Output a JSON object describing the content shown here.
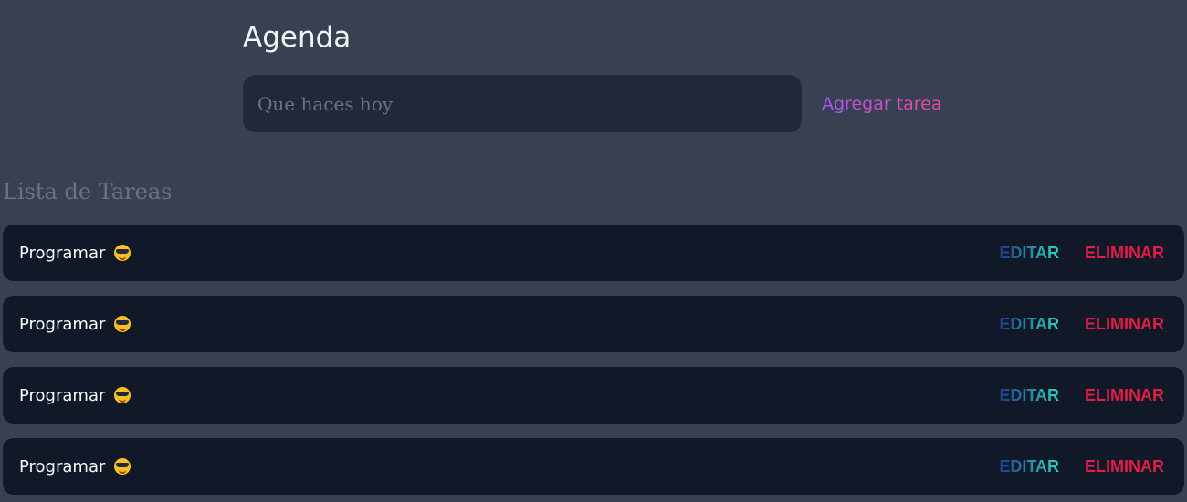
{
  "header": {
    "title": "Agenda"
  },
  "form": {
    "placeholder": "Que haces hoy",
    "value": "",
    "add_label": "Agregar tarea"
  },
  "list": {
    "title": "Lista de Tareas",
    "items": [
      {
        "text": "Programar",
        "icon": "sunglasses-emoji-icon",
        "edit_label": "EDITAR",
        "delete_label": "ELIMINAR"
      },
      {
        "text": "Programar",
        "icon": "sunglasses-emoji-icon",
        "edit_label": "EDITAR",
        "delete_label": "ELIMINAR"
      },
      {
        "text": "Programar",
        "icon": "sunglasses-emoji-icon",
        "edit_label": "EDITAR",
        "delete_label": "ELIMINAR"
      },
      {
        "text": "Programar",
        "icon": "sunglasses-emoji-icon",
        "edit_label": "EDITAR",
        "delete_label": "ELIMINAR"
      }
    ]
  },
  "colors": {
    "background": "#374151",
    "input_background": "#1f2937",
    "item_background": "#111827",
    "add_gradient": [
      "#a855f7",
      "#ec4899"
    ],
    "edit_gradient": [
      "#1e3a8a",
      "#2dd4bf"
    ],
    "delete": "#e11d48"
  }
}
